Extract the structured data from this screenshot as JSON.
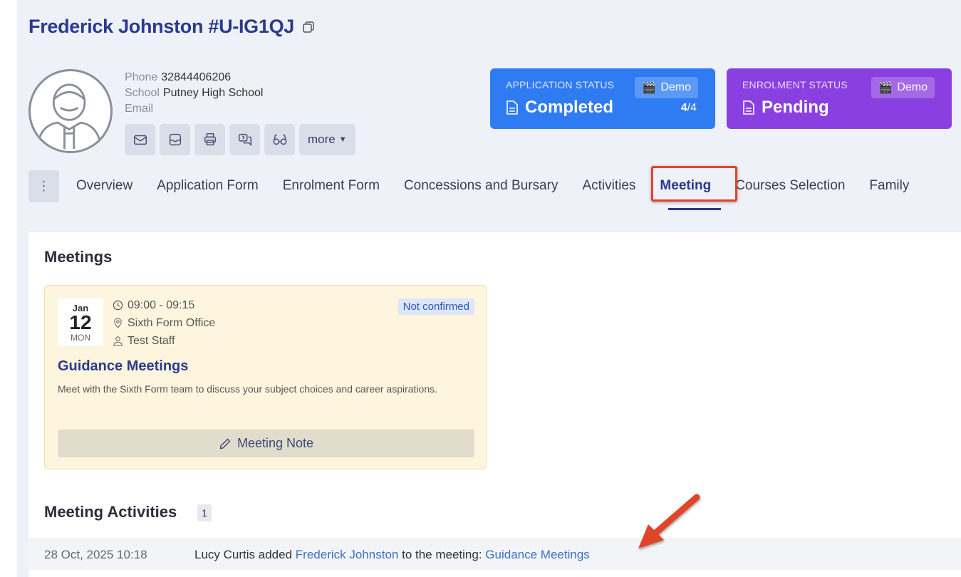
{
  "header": {
    "title": "Frederick Johnston #U-IG1QJ",
    "copy_icon": "copy-icon"
  },
  "profile": {
    "phone_label": "Phone",
    "phone_value": "32844406206",
    "school_label": "School",
    "school_value": "Putney High School",
    "email_label": "Email",
    "email_value": "",
    "actions": [
      "envelope-icon",
      "inbox-icon",
      "printer-icon",
      "chat-icon",
      "glasses-icon"
    ],
    "more_label": "more"
  },
  "application_status": {
    "label": "APPLICATION STATUS",
    "demo_label": "Demo",
    "value": "Completed",
    "count_done": "4",
    "count_total": "/4",
    "color": "#2f7bf2"
  },
  "enrolment_status": {
    "label": "ENROLMENT STATUS",
    "demo_label": "Demo",
    "value": "Pending",
    "color": "#8a3fe0"
  },
  "tabs": {
    "items": [
      "Overview",
      "Application Form",
      "Enrolment Form",
      "Concessions and Bursary",
      "Activities",
      "Meeting",
      "Courses Selection",
      "Family"
    ],
    "active": "Meeting"
  },
  "meetings": {
    "heading": "Meetings",
    "card": {
      "month": "Jan",
      "day": "12",
      "weekday": "MON",
      "time": "09:00 - 09:15",
      "location": "Sixth Form Office",
      "staff": "Test Staff",
      "status": "Not confirmed",
      "title": "Guidance Meetings",
      "description": "Meet with the Sixth Form team to discuss your subject choices and career aspirations.",
      "note_button": "Meeting Note"
    }
  },
  "activities": {
    "heading": "Meeting Activities",
    "count": "1",
    "rows": [
      {
        "time": "28 Oct, 2025 10:18",
        "actor": "Lucy Curtis",
        "verb": "added",
        "target": "Frederick Johnston",
        "middle": "to the meeting:",
        "meeting": "Guidance Meetings"
      }
    ]
  }
}
